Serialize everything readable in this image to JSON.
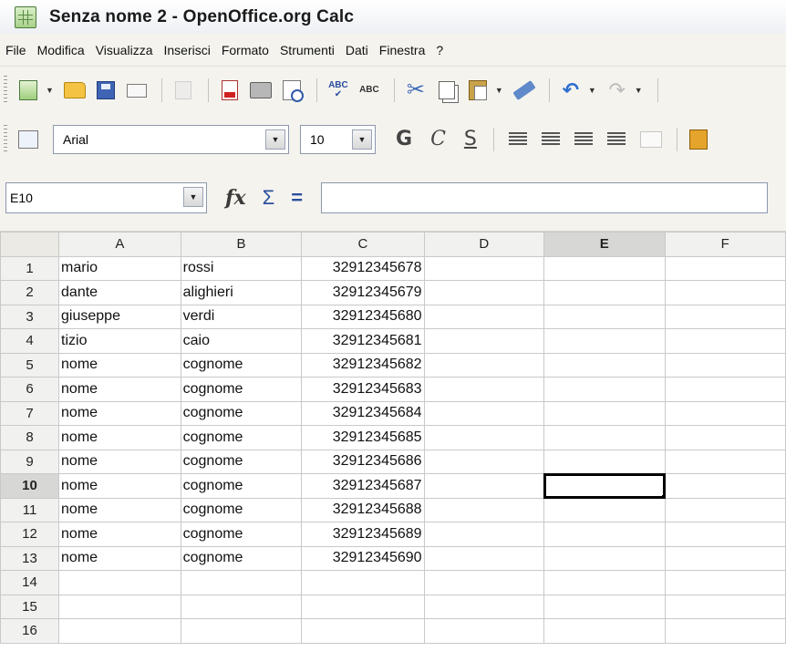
{
  "window": {
    "title": "Senza nome 2 - OpenOffice.org Calc"
  },
  "menu": [
    "File",
    "Modifica",
    "Visualizza",
    "Inserisci",
    "Formato",
    "Strumenti",
    "Dati",
    "Finestra",
    "?"
  ],
  "formatting": {
    "font_name": "Arial",
    "font_size": "10",
    "bold": "G",
    "italic": "C",
    "underline": "S"
  },
  "formula": {
    "cell_ref": "E10",
    "fx": "fx",
    "sum": "Σ",
    "equals": "=",
    "content": ""
  },
  "columns": [
    "A",
    "B",
    "C",
    "D",
    "E",
    "F"
  ],
  "selected": {
    "column": "E",
    "row": "10"
  },
  "rows": [
    {
      "n": "1",
      "a": "mario",
      "b": "rossi",
      "c": "32912345678"
    },
    {
      "n": "2",
      "a": "dante",
      "b": "alighieri",
      "c": "32912345679"
    },
    {
      "n": "3",
      "a": "giuseppe",
      "b": "verdi",
      "c": "32912345680"
    },
    {
      "n": "4",
      "a": "tizio",
      "b": "caio",
      "c": "32912345681"
    },
    {
      "n": "5",
      "a": "nome",
      "b": "cognome",
      "c": "32912345682"
    },
    {
      "n": "6",
      "a": "nome",
      "b": "cognome",
      "c": "32912345683"
    },
    {
      "n": "7",
      "a": "nome",
      "b": "cognome",
      "c": "32912345684"
    },
    {
      "n": "8",
      "a": "nome",
      "b": "cognome",
      "c": "32912345685"
    },
    {
      "n": "9",
      "a": "nome",
      "b": "cognome",
      "c": "32912345686"
    },
    {
      "n": "10",
      "a": "nome",
      "b": "cognome",
      "c": "32912345687"
    },
    {
      "n": "11",
      "a": "nome",
      "b": "cognome",
      "c": "32912345688"
    },
    {
      "n": "12",
      "a": "nome",
      "b": "cognome",
      "c": "32912345689"
    },
    {
      "n": "13",
      "a": "nome",
      "b": "cognome",
      "c": "32912345690"
    },
    {
      "n": "14",
      "a": "",
      "b": "",
      "c": ""
    },
    {
      "n": "15",
      "a": "",
      "b": "",
      "c": ""
    },
    {
      "n": "16",
      "a": "",
      "b": "",
      "c": ""
    }
  ],
  "icons": {
    "standard": [
      "new-icon",
      "open-icon",
      "save-icon",
      "email-icon",
      "edit-file-icon",
      "export-pdf-icon",
      "print-icon",
      "page-preview-icon",
      "spellcheck-icon",
      "autospellcheck-icon",
      "cut-icon",
      "copy-icon",
      "paste-icon",
      "clone-format-icon",
      "undo-icon",
      "redo-icon"
    ],
    "formatting": [
      "navigator-icon",
      "align-left-icon",
      "align-center-icon",
      "align-right-icon",
      "justify-icon",
      "merge-cells-icon",
      "currency-icon"
    ]
  }
}
